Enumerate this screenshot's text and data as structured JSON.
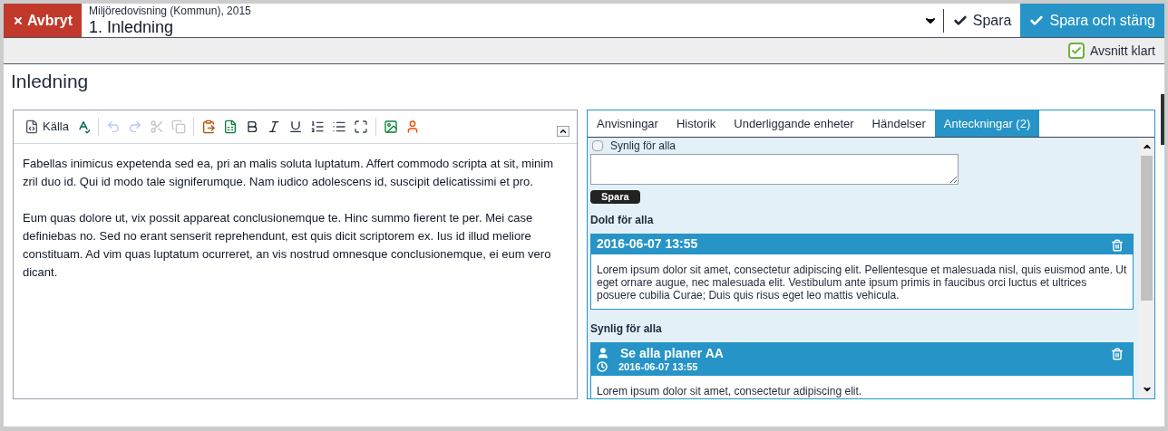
{
  "header": {
    "cancel": "Avbryt",
    "subtitle": "Miljöredovisning (Kommun), 2015",
    "title": "1. Inledning",
    "save": "Spara",
    "save_close": "Spara och stäng"
  },
  "section_done": {
    "label": "Avsnitt klart",
    "checked": true
  },
  "page_title": "Inledning",
  "editor": {
    "toolbar": [
      {
        "kind": "source",
        "label": "Källa",
        "disabled": false
      },
      {
        "kind": "spellcheck",
        "disabled": false
      },
      {
        "kind": "separator"
      },
      {
        "kind": "undo",
        "disabled": true
      },
      {
        "kind": "redo",
        "disabled": true
      },
      {
        "kind": "cut",
        "disabled": true
      },
      {
        "kind": "copy",
        "disabled": true
      },
      {
        "kind": "separator"
      },
      {
        "kind": "paste-word",
        "disabled": false
      },
      {
        "kind": "paste-excel",
        "disabled": false
      },
      {
        "kind": "bold",
        "disabled": false
      },
      {
        "kind": "italic",
        "disabled": false
      },
      {
        "kind": "underline",
        "disabled": false
      },
      {
        "kind": "numbered-list",
        "disabled": false
      },
      {
        "kind": "bullet-list",
        "disabled": false
      },
      {
        "kind": "maximize",
        "disabled": false
      },
      {
        "kind": "separator"
      },
      {
        "kind": "image",
        "disabled": false
      },
      {
        "kind": "person",
        "disabled": false
      }
    ],
    "paragraphs": [
      "Fabellas inimicus expetenda sed ea, pri an malis soluta luptatum. Affert commodo scripta at sit, minim zril duo id. Qui id modo tale signiferumque. Nam iudico adolescens id, suscipit delicatissimi et pro.",
      "Eum quas dolore ut, vix possit appareat conclusionemque te. Hinc summo fierent te per. Mei case definiebas no. Sed no erant senserit reprehendunt, est quis dicit scriptorem ex. Ius id illud meliore constituam. Ad vim quas luptatum ocurreret, an vis nostrud omnesque conclusionemque, ei eum vero dicant."
    ]
  },
  "tabs": [
    {
      "label": "Anvisningar",
      "selected": false
    },
    {
      "label": "Historik",
      "selected": false
    },
    {
      "label": "Underliggande enheter",
      "selected": false
    },
    {
      "label": "Händelser",
      "selected": false
    },
    {
      "label": "Anteckningar (2)",
      "selected": true
    }
  ],
  "new_note": {
    "visible_label": "Synlig för alla",
    "checked": false,
    "save": "Spara"
  },
  "sections": [
    {
      "heading": "Dold för alla",
      "notes": [
        {
          "kind": "plain",
          "date": "2016-06-07 13:55",
          "text": "Lorem ipsum dolor sit amet, consectetur adipiscing elit. Pellentesque et malesuada nisl, quis euismod ante. Ut eget ornare augue, nec malesuada elit. Vestibulum ante ipsum primis in faucibus orci luctus et ultrices posuere cubilia Curae; Duis quis risus eget leo mattis vehicula."
        }
      ]
    },
    {
      "heading": "Synlig för alla",
      "notes": [
        {
          "kind": "author",
          "author": "Se alla planer AA",
          "date": "2016-06-07 13:55",
          "text": "Lorem ipsum dolor sit amet, consectetur adipiscing elit."
        }
      ]
    }
  ]
}
